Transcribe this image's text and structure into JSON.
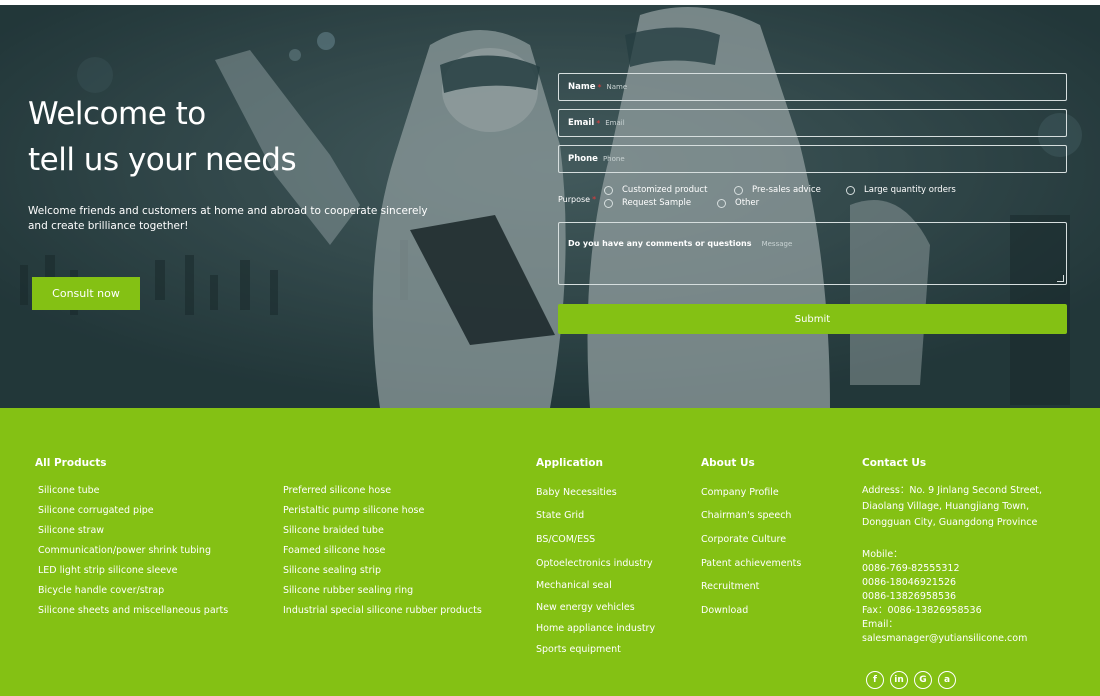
{
  "hero": {
    "title_line1": "Welcome to",
    "title_line2": "tell us your needs",
    "description": "Welcome friends and customers at home and abroad to cooperate sincerely and create brilliance together!",
    "consult_label": "Consult now"
  },
  "form": {
    "name_label": "Name",
    "name_placeholder": "Name",
    "email_label": "Email",
    "email_placeholder": "Email",
    "phone_label": "Phone",
    "phone_placeholder": "Phone",
    "required_mark": "*",
    "purpose_label": "Purpose",
    "purpose_options": [
      "Customized product",
      "Pre-sales advice",
      "Large quantity orders",
      "Request Sample",
      "Other"
    ],
    "message_label": "Do you have any comments or questions",
    "message_placeholder": "Message",
    "submit_label": "Submit"
  },
  "footer": {
    "products_title": "All Products",
    "products_col1": [
      "Silicone tube",
      "Silicone corrugated pipe",
      "Silicone straw",
      "Communication/power shrink tubing",
      "LED light strip silicone sleeve",
      "Bicycle handle cover/strap",
      "Silicone sheets and miscellaneous parts"
    ],
    "products_col2": [
      "Preferred silicone hose",
      "Peristaltic pump silicone hose",
      "Silicone braided tube",
      "Foamed silicone hose",
      "Silicone sealing strip",
      "Silicone rubber sealing ring",
      "Industrial special silicone rubber products"
    ],
    "application_title": "Application",
    "application_items": [
      "Baby Necessities",
      "State Grid",
      "BS/COM/ESS",
      "Optoelectronics industry",
      "Mechanical seal",
      "New energy vehicles",
      "Home appliance industry",
      "Sports equipment"
    ],
    "about_title": "About Us",
    "about_items": [
      "Company Profile",
      "Chairman's speech",
      "Corporate Culture",
      "Patent achievements",
      "Recruitment",
      "Download"
    ],
    "contact_title": "Contact Us",
    "address_line1": "Address：No. 9 Jinlang Second Street,",
    "address_line2": "Diaolang Village, Huangjiang Town,",
    "address_line3": "Dongguan City, Guangdong Province",
    "mobile_label": "Mobile：",
    "mobile_1": "0086-769-82555312",
    "mobile_2": "0086-18046921526",
    "mobile_3": "0086-13826958536",
    "fax": "Fax：0086-13826958536",
    "email_label": "Email：",
    "email": "salesmanager@yutiansilicone.com",
    "social_icons": [
      "facebook-icon",
      "linkedin-icon",
      "google-icon",
      "alibaba-icon"
    ]
  },
  "colors": {
    "accent": "#84c114",
    "hero_bg": "#2c4346"
  }
}
